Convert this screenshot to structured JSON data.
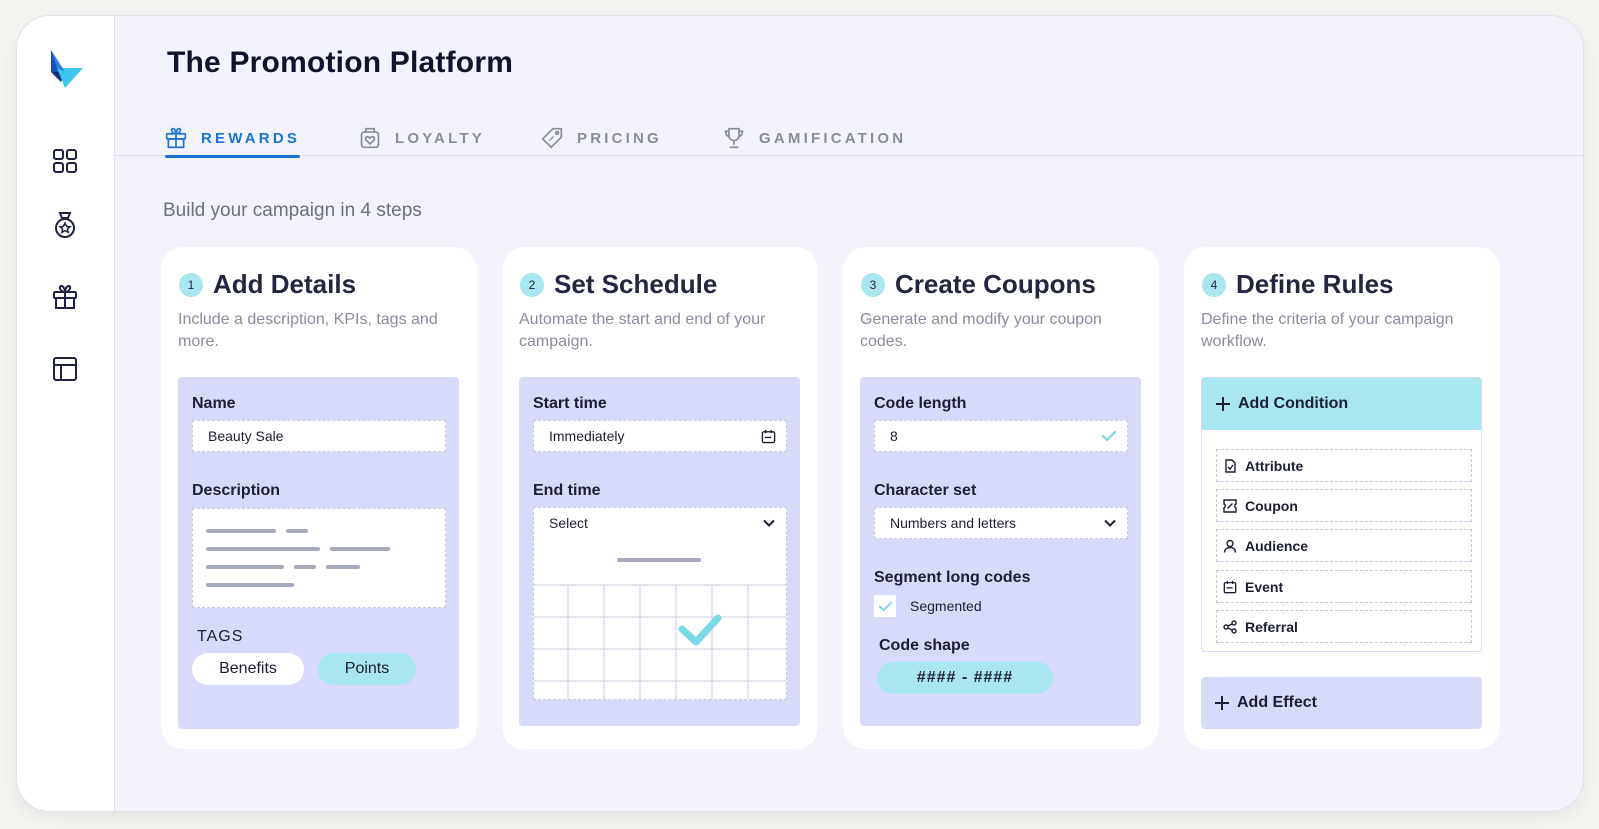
{
  "app": {
    "title": "The Promotion Platform"
  },
  "sidebar": {
    "items": [
      {
        "icon": "grid-icon"
      },
      {
        "icon": "medal-icon"
      },
      {
        "icon": "gift-icon"
      },
      {
        "icon": "layout-icon"
      }
    ]
  },
  "tabs": [
    {
      "label": "REWARDS",
      "icon": "gift-icon",
      "active": true
    },
    {
      "label": "LOYALTY",
      "icon": "heart-box-icon",
      "active": false
    },
    {
      "label": "PRICING",
      "icon": "price-tag-icon",
      "active": false
    },
    {
      "label": "GAMIFICATION",
      "icon": "trophy-icon",
      "active": false
    }
  ],
  "subtitle": "Build your campaign in 4 steps",
  "steps": [
    {
      "num": "1",
      "title": "Add Details",
      "desc": "Include a description, KPIs, tags and more.",
      "name_label": "Name",
      "name_value": "Beauty Sale",
      "description_label": "Description",
      "tags_label": "TAGS",
      "tags": [
        "Benefits",
        "Points"
      ]
    },
    {
      "num": "2",
      "title": "Set Schedule",
      "desc": "Automate the start and end of your campaign.",
      "start_label": "Start time",
      "start_value": "Immediately",
      "end_label": "End time",
      "end_value": "Select"
    },
    {
      "num": "3",
      "title": "Create Coupons",
      "desc": "Generate and modify your coupon codes.",
      "length_label": "Code length",
      "length_value": "8",
      "charset_label": "Character set",
      "charset_value": "Numbers and letters",
      "segment_label": "Segment long codes",
      "segment_option": "Segmented",
      "shape_label": "Code shape",
      "shape_value": "#### - ####"
    },
    {
      "num": "4",
      "title": "Define Rules",
      "desc": "Define the criteria of your campaign workflow.",
      "add_condition": "Add Condition",
      "conditions": [
        {
          "label": "Attribute",
          "icon": "attribute-icon"
        },
        {
          "label": "Coupon",
          "icon": "coupon-icon"
        },
        {
          "label": "Audience",
          "icon": "user-icon"
        },
        {
          "label": "Event",
          "icon": "calendar-icon"
        },
        {
          "label": "Referral",
          "icon": "share-icon"
        }
      ],
      "add_effect": "Add Effect"
    }
  ],
  "colors": {
    "accent": "#1a73d4",
    "panel": "#d7daf9",
    "cyan": "#a8e6f0",
    "background": "#f3f3fb"
  }
}
